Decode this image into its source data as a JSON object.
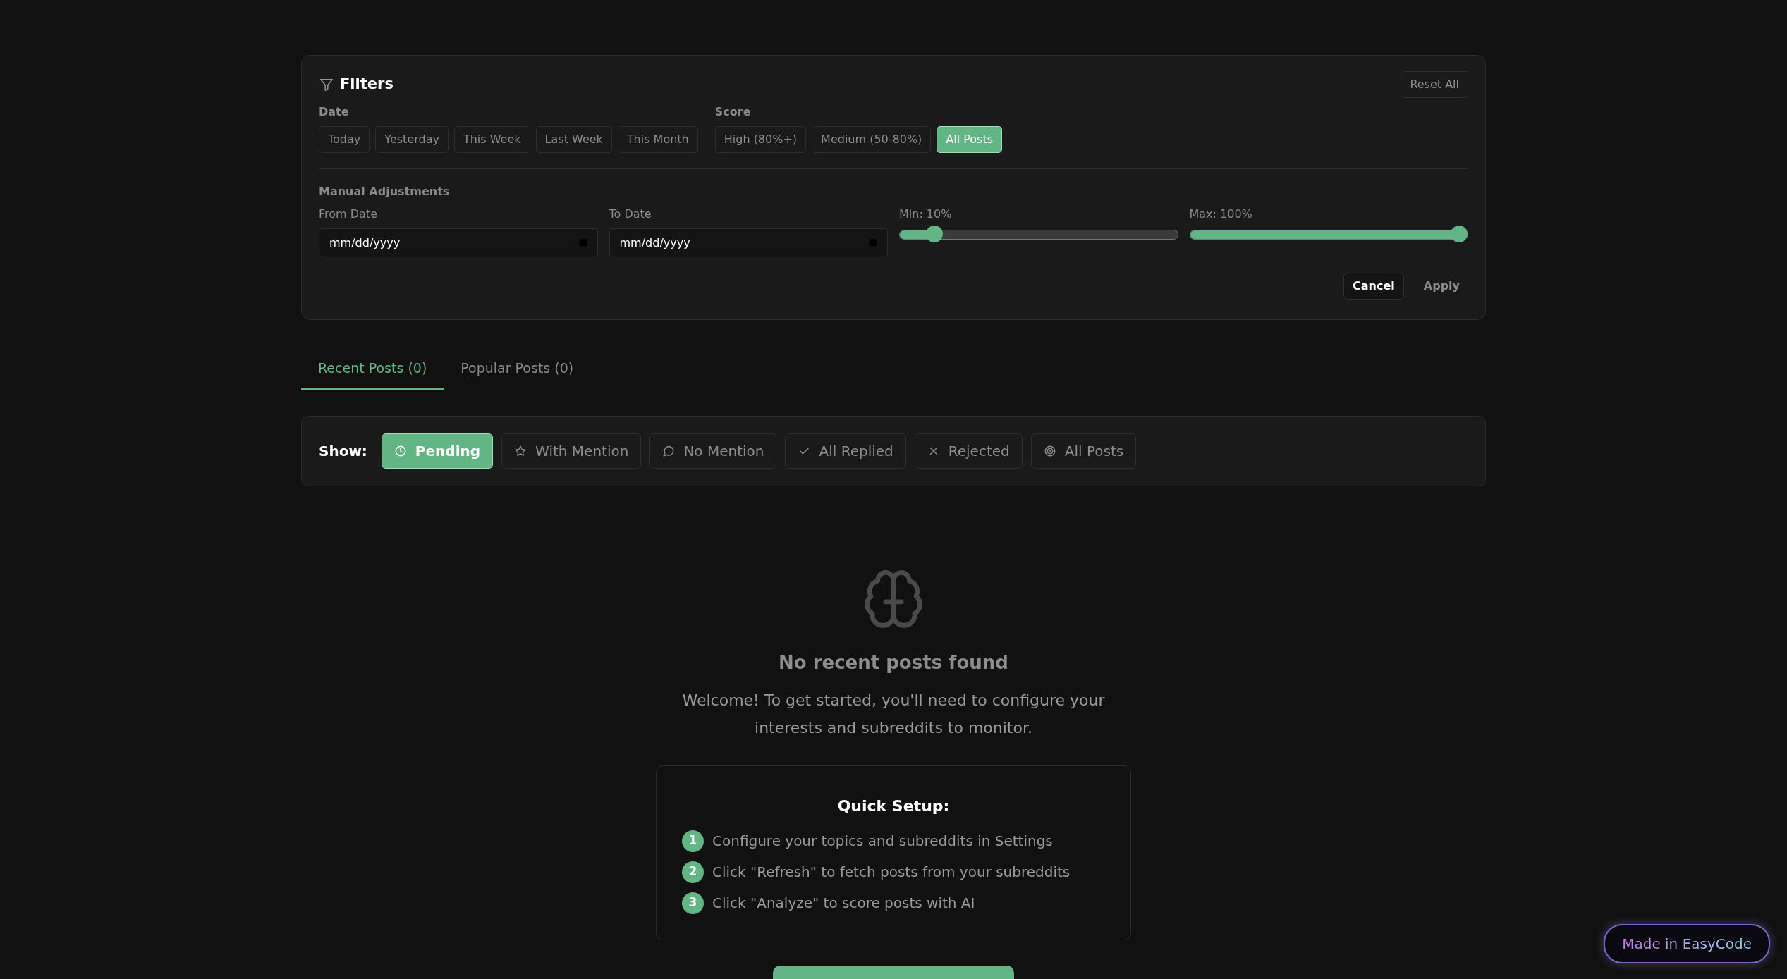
{
  "filters": {
    "title": "Filters",
    "reset_button": "Reset All",
    "date": {
      "label": "Date",
      "options": [
        {
          "label": "Today",
          "selected": false
        },
        {
          "label": "Yesterday",
          "selected": false
        },
        {
          "label": "This Week",
          "selected": false
        },
        {
          "label": "Last Week",
          "selected": false
        },
        {
          "label": "This Month",
          "selected": false
        }
      ]
    },
    "score": {
      "label": "Score",
      "options": [
        {
          "label": "High (80%+)",
          "selected": false
        },
        {
          "label": "Medium (50-80%)",
          "selected": false
        },
        {
          "label": "All Posts",
          "selected": true
        }
      ]
    },
    "manual": {
      "title": "Manual Adjustments",
      "from_date": {
        "label": "From Date",
        "placeholder": "mm/dd/yyyy"
      },
      "to_date": {
        "label": "To Date",
        "placeholder": "mm/dd/yyyy"
      },
      "min_slider": {
        "label": "Min: 10%",
        "level": 0.1
      },
      "max_slider": {
        "label": "Max: 100%",
        "level": 1.0
      }
    },
    "buttons": [
      "Cancel",
      "Apply"
    ]
  },
  "tabs": [
    {
      "label": "Recent Posts (0)",
      "selected": true
    },
    {
      "label": "Popular Posts (0)",
      "selected": false
    }
  ],
  "show_bar": {
    "label": "Show:",
    "options": [
      {
        "label": "Pending",
        "selected": true
      },
      {
        "label": "With Mention",
        "selected": false
      },
      {
        "label": "No Mention",
        "selected": false
      },
      {
        "label": "All Replied",
        "selected": false
      },
      {
        "label": "Rejected",
        "selected": false
      },
      {
        "label": "All Posts",
        "selected": false
      }
    ]
  },
  "empty_state": {
    "title": "No recent posts found",
    "message": "Welcome! To get started, you'll need to configure your interests and subreddits to monitor.",
    "setup": {
      "title": "Quick Setup:",
      "steps": [
        {
          "number": "1",
          "text": "Configure your topics and subreddits in Settings"
        },
        {
          "number": "2",
          "text": "Click \"Refresh\" to fetch posts from your subreddits"
        },
        {
          "number": "3",
          "text": "Click \"Analyze\" to score posts with AI"
        }
      ]
    }
  },
  "badge": "Made in EasyCode"
}
